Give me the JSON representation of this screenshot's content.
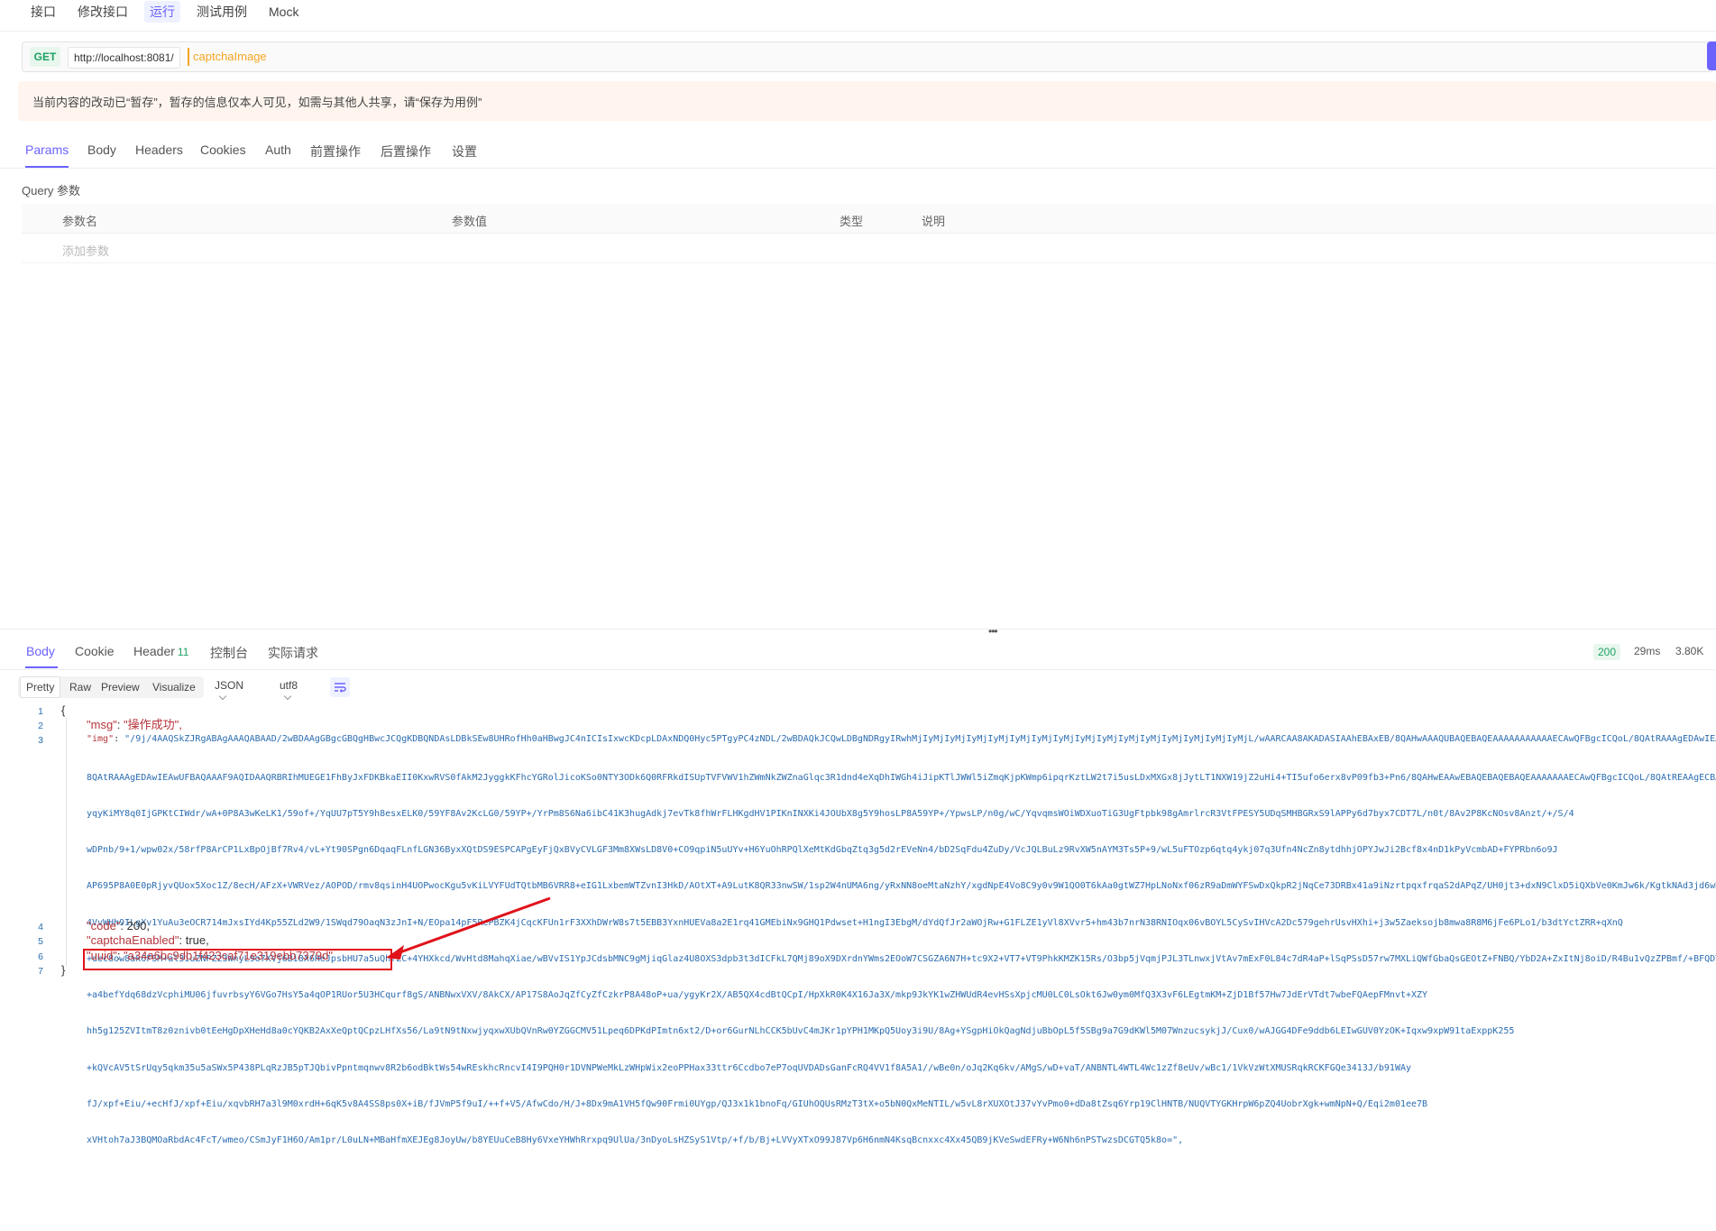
{
  "top_tabs": [
    "接口",
    "修改接口",
    "运行",
    "测试用例",
    "Mock"
  ],
  "request": {
    "method": "GET",
    "base_url": "http://localhost:8081/",
    "path": "captchaImage"
  },
  "notice": "当前内容的改动已“暂存”，暂存的信息仅本人可见，如需与其他人共享，请“保存为用例”",
  "request_tabs": [
    "Params",
    "Body",
    "Headers",
    "Cookies",
    "Auth",
    "前置操作",
    "后置操作",
    "设置"
  ],
  "query": {
    "title": "Query 参数",
    "columns": [
      "参数名",
      "参数值",
      "类型",
      "说明"
    ],
    "add_placeholder": "添加参数"
  },
  "response_tabs": {
    "body": "Body",
    "cookie": "Cookie",
    "header": "Header",
    "header_count": "11",
    "console": "控制台",
    "actual": "实际请求"
  },
  "response_stats": {
    "status": "200",
    "time": "29ms",
    "size": "3.80K"
  },
  "view_modes": [
    "Pretty",
    "Raw",
    "Preview",
    "Visualize"
  ],
  "format": "JSON",
  "encoding": "utf8",
  "code_lines": {
    "l1": "{",
    "msg_key": "\"msg\"",
    "msg_val": "\"操作成功\",",
    "img_key": "\"img\"",
    "img_start": "\"/9j/4AAQSkZJRgABAgAAAQABAAD/2wBDAAgGBgcGBQgHBwcJCQgKDBQNDAsLDBkSEw8UHRofHh0aHBwgJC4nICIsIxwcKDcpLDAxNDQ0Hyc5PTgyPC4zNDL/2wBDAQkJCQwLDBgNDRgyIRwhMjIyMjIyMjIyMjIyMjIyMjIyMjIyMjIyMjIyMjIyMjIyMjIyMjIyMjIyMjIyMjL/wAARCAA8AKADASIAAhEBAxEB/8QAHwAAAQUBAQEBAQEAAAAAAAAAAAECAwQFBgcICQoL/8QAtRAAAgEDAwIEAwUFBAQAAAF9AQIDAAQRBRIhMUEGE1FhByJxFDKBkaEII0KxwRVS0fAkM2JyggkKFhcYGRoaJSYnKCkqNDU2Nzg5OkNERUZHSElKU1RVVldYWVpjZGVmZ2hpanN0dXZ3eHl6g4SFhoeIiYqSk5SVlpeYmZqio6Slpqeoqaqys7S1tre4ubrCw8TFxsfIycrS09TV1tfY2drh4uPk5ebn6Onq8fLz9PX29/j5+v/EAB8BAAMBAQEBAQEBAQEAAAAAAAABAgMEBQYHCAkKC//EALURAAIBAgQEAwQHBQQEAAECdwABAgMRBAUhMQYSQVEHYXETIjKBCBRCkaGxwQkjM1LwFWJy0QoWJDThJfEXGBkaJicoKSo1Njc4OTpDREVGR0hJSlNUVVZXWFlaY2RlZmdoaWpzdHV2d3h5eoKDhIWGh4iJipKTlJWWl5iZmqKjpKWmp6ipqrKztLW2t7i5usLDxMXGx8jJytLT1NXW19jZ2uLj5OXm5+jp6vLz9PX29/j5+v/aAAwDAQACEQMRAD8A7q8q0IjGPKtCIWdr/wA+0P8A3wKeLK1/59of+YqUU7pT5Y9h8esWVI/59Fv8Av2KcLG0/59YP+YrPm8S6Na6ibC41KeLG4XV6P+YpwsLP/n0g/WC/YqvqbgmqpY+tY8QjPUbbdyUwEvUG/8AI78Q+c6VDwKgx7VW8Q5M0nVufIw4Nd1fpSGmdwTm4QAWNvz+LDpm5Ndlzs/Ikrjf3YUNoSqRXi/d0Jm17PgdWZ2fdLd94Bm+hzEhHbM8fpFs/b+BmW/zGZ3X2MEkHYQ5/+3z4AkfSmqUJXeVyVHsMu5Fl2KvJZuUH6OK1j6JEjMg1wGr0rXKe3w5R6ep3rzV9fHnUZ6ufiNVqjZ4A6UFzixPzMJZ5FTqLPc5Xn5K9jY9tgLkWbcCf+S1k6K8nLeHHpTPuiPomVdhjpLvuL2//2Q==\",",
    "img_key_b": "",
    "code_key": "\"code\"",
    "code_val": "200,",
    "cap_key": "\"captchaEnabled\"",
    "cap_val": "true,",
    "uuid_key": "\"uuid\"",
    "uuid_val": "\"a34a6bc9db1f423caf71e319ebb7379d\"",
    "l7": "}"
  },
  "img_blob_lines": [
    "8QAtRAAAgEDAwIEAwUFBAQAAAF9AQIDAAQRBRIhMUEGE1FhByJxFDKBkaEII0KxwRVS0fAkM2JyggkKFhcYGRolJicoKSo0NTY3ODk6Q0RFRkdISUpTVFVWV1hZWmNkZWZnaGlqc3R1dnd4eXqDhIWGh4iJipKTlJWWl5iZmqKjpKWmp6ipqrKztLW2t7i5usLDxMXGx8jJytLT1NXW19jZ2uHi4+TI5ufo6erx8vP09fb3+Pn6/8QAHwEAAwEBAQEBAQEBAQEAAAAAAAECAwQFBgcICQoL/8QAtREAAgECBAQDBAcFBAQAAQJ3AAECAxEEBSExBhJBUQdhcRMiMoEIFEKRobHBCSMzUvAVYnLRChYkNOEl8RcYGRomJygpKjU2Nzg5OkNERUZHSElKU1RVVldYWVpjZGVmZ2hpanN0dXZ3eHl6goOEhYaHiImKkpOUlZaXmJmaoqOkpaanqKmqsrO0tba3uLm6wsPExcbHyMnK0tPU1dbX2Nna4uPk5ebn6Onq8vP09fb3+Pn6/9oADAMBAAIRAxEAPwDrW1ga1nZoIy",
    "yqyKiMY8q0IjGPKtCIWdr/wA+0P8A3wKeLK1/59of+/YqUU7pT5Y9h8esxELK0/59YF8Av2KcLG0/59YP+/YrPm8S6Na6ibC41K3hugAdkj7evTk8fhWrFLHKgdHV1PIKnINXKi4JOUbX8g5Y9hosLP8A59YP+/YpwsLP/n0g/wC/YqvqmsWOiWDXuoTiG3UgFtpbk98gAmrlrcR3VtFPESY5UDqSMHBGRxS9lAPPy6d7byx7CDT7L/n0t/8Av2P8KcNOsv8Anzt/+/S/4",
    "wDPnb/9+1/wpw02x/58rfP8ArCP1LxBpOjBf7Rv4/vL+Yt90SPgn6DqaqFLnfLGN36ByxXQtDS9ESPCAPgEyFjQxBVyCVLGF3Mm8XWsLD8V0+CO9qpiN5uUYv+H6YuOhRPQlXeMtKdGbqZtq3g5d2rEVeNn4/bD2SqFdu4ZuDy/VcJQLBuLz9RvXW5nAYM3Ts5P+9/wL5uFTOzp6qtq4ykj07q3Ufn4NcZn8ytdhhjOPYJwJi2Bcf8x4nD1kPyVcmbAD+FYPRbn6o9J",
    "AP695P8A0E0pRjyvQUox5Xoc1Z/8ecH/AFzX+VWRVez/AOPOD/rmv8qsinH4UOPwocKgu5vKiLVYFUdTQtbMB6VRR8+eIG1LxbemWTZvnI3HkD/AOtXT+A9LutK8QR33nwSW/1sp2W4nUMA6ng/yRxNN8oeMtaNzhY/xgdNpE4Vo8C9y0v9W1QO0T6kAa0gtWZ7HpLNoNxf06zR9aDmWYFSwDxQkpR2jNqCe73DRBx41a9iNzrtpqxfrqaS2dAPqZ/UH0jt3+dxN9ClxD5iQXbVe0KmJw6k/KgtkNAd3jd6wHBb1ZjMdbNv+U1IJ+cc3YIZFyd6k2CGy9Sxq",
    "4VvWHh9ILgXv1YuAu3eOCR714mJxsIYd4Kp55ZLd2W9/1SWqd79OaqN3zJnI+N/EOpa14pF5RePBZK4jCqcKFUn1rF3XXhDWrW8s7t5EBB3YxnHUEVa8a2E1rq41GMEbiNx9GHQ1Pdwset+H1ngI3EbgM/dYdQfJr2aWOjRw+G1FLZE1yVl8XVvr5+hm43b7nrN38RNIOqx06vBOYL5CySvIHVcA2Dc579gehrUsvHXhi+j3w5Zaeksojb8mwa8R8M6jFe6PLo1/b3dtYctZRR+qXnQ",
    "+dec8ow8ak6FSM+al3iuZNPZ23WnyL9o7XVj6Bi8X6HeJpsbHU7a5uQhfZC+4YHXkcd/WvHtd8MahqXiae/wBVvIS1YpJCdsbMNC9gMjiqGlaz4U8OXS3dpb3t3dICFkL7QMj89oX9DXrdnYWms2EOoW7CSGZA6N7H+tc9X2+VT7+VT9PhkKMZK15Rs/O3bp5jVqmjPJL3TLnwxjVtAv7mExF0L84c7dR4aP+lSqPSsD57rw7MXLiQWfGbaQsGEOtZ+FNBQ/YbD2A+ZxItNj8oiD/R4Bu1vQzZPBmf/+BFQDYe7sH08A9zF5fbG4i23D51Nz",
    "+a4befYdq68dzVcphiMU06jfuvrbsyY6VGo7HsY5a4qOP1RUor5U3HCqurf8gS/ANBNwxVXV/8AkCX/AP17S8AoJqZfCyZfCzkrP8A48oP+ua/ygyKr2X/AB5QX4cdBtQCpI/HpXkR0K4X16Ja3X/mkp9JkYK1wZHWUdR4evHSsXpjcMU0LC0LsOkt6Jw0ym0MfQ3X3vF6LEgtmKM+ZjD1Bf57Hw7JdErVTdt7wbeFQAepFMnvt+XZY",
    "hh5g125ZVItmT8z0znivb0tEeHgDpXHeHd8a0cYQKB2AxXeQptQCpzLHfXs56/La9tN9tNxwjyqxwXUbQVnRw0YZGGCMV51Lpeq6DPKdPImtn6xt2/D+or6GurNLhCCK5bUvC4mJKr1pYPH1MKpQ5Uoy3i9U/8Ag+YSgpHiOkQagNdjuBbOpL5f5SBg9a7G9dKWl5M07WnzucsykjJ/Cux0/wAJGG4DFe9ddb6LEIwGUV0YzOK+Iqxw9xpW91taExppK255",
    "+kQVcAV5tSrUqy5qkm35u5aSWx5P438PLqRzJB5pTJQbivPpntmqnwv8R2b6odBktWs54wREskhcRncvI4I9PQH0r1DVNPWeMkLzWHpWix2eoPPHax33ttr6Ccdbo7eP7oqUVDADsGanFcRQ4VV1f8A5A1//wBe0n/oJq2Kq6kv/AMgS/wD+vaT/ANBNTL4WTL4Wc1zZf8eUv/wBc1/1VkVzWtXMUSRqkRCKFGQe3413J/b91WAy",
    "fJ/xpf+Eiu/+ecHfJ/xpf+Eiu/xqvbRH7a3l9M0xrdH+6qK5v8A4SS8ps0X+iB/fJVmP5f9uI/++f+V5/AfwCdo/H/J+8Dx9mA1VH5fQw90Frmi0UYgp/QJ3x1k1bnoFq/GIUhOQUsRMzT3tX+o5bN0QxMeNTIL/w5vL8rXUXOtJ37vYvPmo0+dDa8tZsq6Yrp19ClHNTB/NUQVTYGKHrpW6pZQ4UobrXgk+wmNpN+Q/Eqi2m01ee7B",
    "xVHtoh7aJ3BQMOaRbdAc4FcT/wmeo/CSmJyF1H6O/Am1pr/L0uLN+MBaHfmXEJEg8JoyUw/b8YEUuCeB8Hy6VxeYHWhRrxpq9UlUa/3nDyoLsHZSyS1Vtp/+f/b/Bj+LVVyXTxO99J87Vp6H6nmN4KsqBcnxxc4Xx45QB9jKVeSwdEFRy+W6Nh6nPSTwzsDCGTQ5k8o=\","
  ]
}
